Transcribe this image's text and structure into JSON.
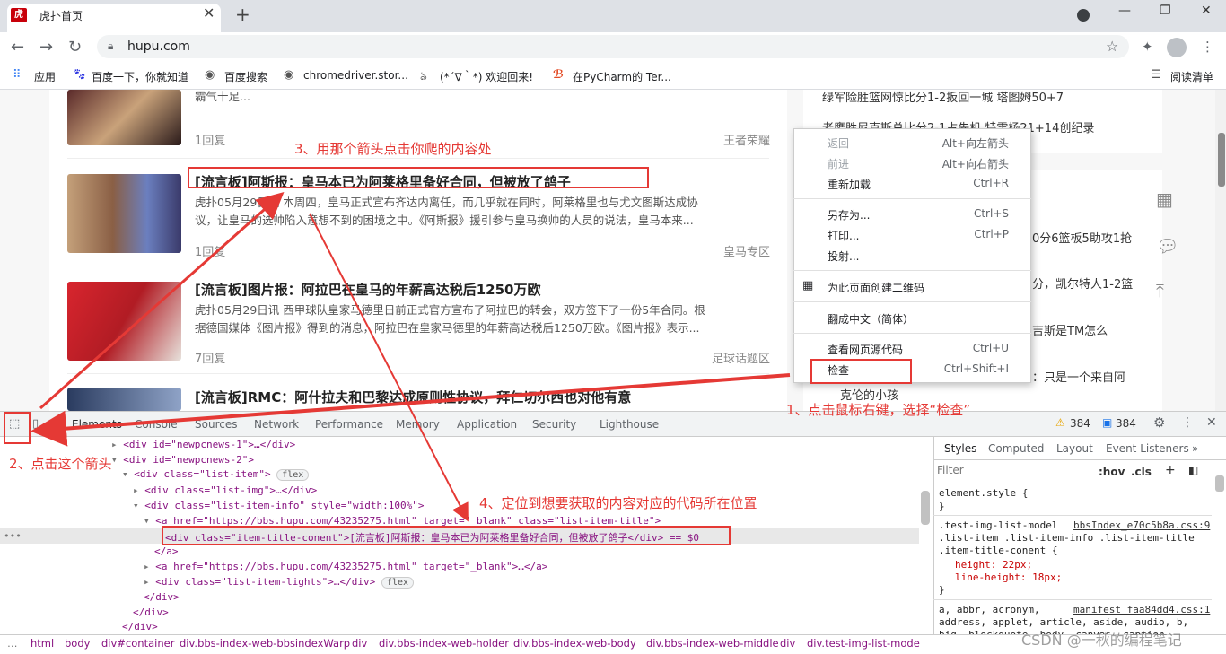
{
  "browser": {
    "tab_title": "虎扑首页",
    "tab_favicon_text": "虎",
    "url": "hupu.com",
    "bookmarks": [
      "应用",
      "百度一下，你就知道",
      "百度搜索",
      "chromedriver.stor...",
      "(*´∇｀*) 欢迎回来!",
      "在PyCharm的 Ter..."
    ],
    "reading_list": "阅读清单"
  },
  "page": {
    "top_item_snippet": "霸气十足...",
    "top_item_replies": "1回复",
    "top_item_tag": "王者荣耀",
    "articles": [
      {
        "title": "[流言板]阿斯报：皇马本已为阿莱格里备好合同，但被放了鸽子",
        "desc1": "虎扑05月29日讯 本周四，皇马正式宣布齐达内离任，而几乎就在同时，阿莱格里也与尤文图斯达成协",
        "desc2": "议，让皇马的选帅陷入意想不到的困境之中。《阿斯报》援引参与皇马换帅的人员的说法，皇马本来...",
        "replies": "1回复",
        "tag": "皇马专区"
      },
      {
        "title": "[流言板]图片报：阿拉巴在皇马的年薪高达税后1250万欧",
        "desc1": "虎扑05月29日讯 西甲球队皇家马德里日前正式官方宣布了阿拉巴的转会，双方签下了一份5年合同。根",
        "desc2": "据德国媒体《图片报》得到的消息，阿拉巴在皇家马德里的年薪高达税后1250万欧。《图片报》表示...",
        "replies": "7回复",
        "tag": "足球话题区"
      },
      {
        "title": "[流言板]RMC：阿什拉夫和巴黎达成原则性协议，拜仁切尔西也对他有意"
      }
    ],
    "right_items": [
      "绿军险胜篮网惊比分1-2扳回一城 塔图姆50+7",
      "老鹰胜尼克斯总比分2-1占先机 特雷杨21+14创纪录",
      "0分6篮板5助攻1抢",
      "分，凯尔特人1-2篮",
      "吉斯是TM怎么",
      "：只是一个来自阿",
      "克伦的小孩"
    ]
  },
  "context_menu": {
    "items": [
      {
        "label": "返回",
        "shortcut": "Alt+向左箭头",
        "disabled": true
      },
      {
        "label": "前进",
        "shortcut": "Alt+向右箭头",
        "disabled": true
      },
      {
        "label": "重新加载",
        "shortcut": "Ctrl+R",
        "disabled": false
      },
      {
        "label": "另存为...",
        "shortcut": "Ctrl+S",
        "disabled": false
      },
      {
        "label": "打印...",
        "shortcut": "Ctrl+P",
        "disabled": false
      },
      {
        "label": "投射...",
        "shortcut": "",
        "disabled": false
      },
      {
        "label": "为此页面创建二维码",
        "shortcut": "",
        "disabled": false
      },
      {
        "label": "翻成中文（简体）",
        "shortcut": "",
        "disabled": false
      },
      {
        "label": "查看网页源代码",
        "shortcut": "Ctrl+U",
        "disabled": false
      },
      {
        "label": "检查",
        "shortcut": "Ctrl+Shift+I",
        "disabled": false
      }
    ]
  },
  "devtools": {
    "tabs": [
      "Elements",
      "Console",
      "Sources",
      "Network",
      "Performance",
      "Memory",
      "Application",
      "Security",
      "Lighthouse"
    ],
    "warn_count": "384",
    "info_count": "384",
    "dom_lines": [
      "<div id=\"newpcnews-1\">…</div>",
      "<div id=\"newpcnews-2\">",
      "<div class=\"list-item\">",
      "<div class=\"list-img\">…</div>",
      "<div class=\"list-item-info\" style=\"width:100%\">",
      "<a href=\"https://bbs.hupu.com/43235275.html\" target=\"_blank\" class=\"list-item-title\">",
      "<div class=\"item-title-conent\">[流言板]阿斯报：皇马本已为阿莱格里备好合同，但被放了鸽子</div> == $0",
      "</a>",
      "<a href=\"https://bbs.hupu.com/43235275.html\" target=\"_blank\">…</a>",
      "<div class=\"list-item-lights\">…</div>",
      "</div>",
      "</div>"
    ],
    "flex_badge": "flex",
    "styles_tabs": [
      "Styles",
      "Computed",
      "Layout",
      "Event Listeners",
      "»"
    ],
    "filter_placeholder": "Filter",
    "filter_hov": ":hov",
    "filter_cls": ".cls",
    "css_rules": [
      "element.style {",
      "}",
      ".test-img-list-model",
      "bbsIndex_e70c5b8a.css:9",
      ".list-item .list-item-info .list-item-title",
      ".item-title-conent {",
      "height: 22px;",
      "line-height: 18px;",
      "}",
      "a, abbr, acronym,",
      "manifest_faa84dd4.css:1",
      "address, applet, article, aside, audio, b,",
      "big, blockquote, body, canvas, caption,",
      "center, cite, code, dd, del, details, dfn,"
    ],
    "breadcrumbs": [
      "html",
      "body",
      "div#container",
      "div.bbs-index-web-bbsindexWarp",
      "div",
      "div.bbs-index-web-holder",
      "div.bbs-index-web-body",
      "div.bbs-index-web-middle",
      "div",
      "div.test-img-list-mode"
    ]
  },
  "annotations": {
    "step1": "1、点击鼠标右键，选择“检查”",
    "step2": "2、点击这个箭头",
    "step3": "3、用那个箭头点击你爬的内容处",
    "step4": "4、定位到想要获取的内容对应的代码所在位置",
    "watermark": "CSDN @一秋的编程笔记"
  },
  "colors": {
    "annotation_red": "#e53935",
    "hupu_red": "#c8000a"
  }
}
